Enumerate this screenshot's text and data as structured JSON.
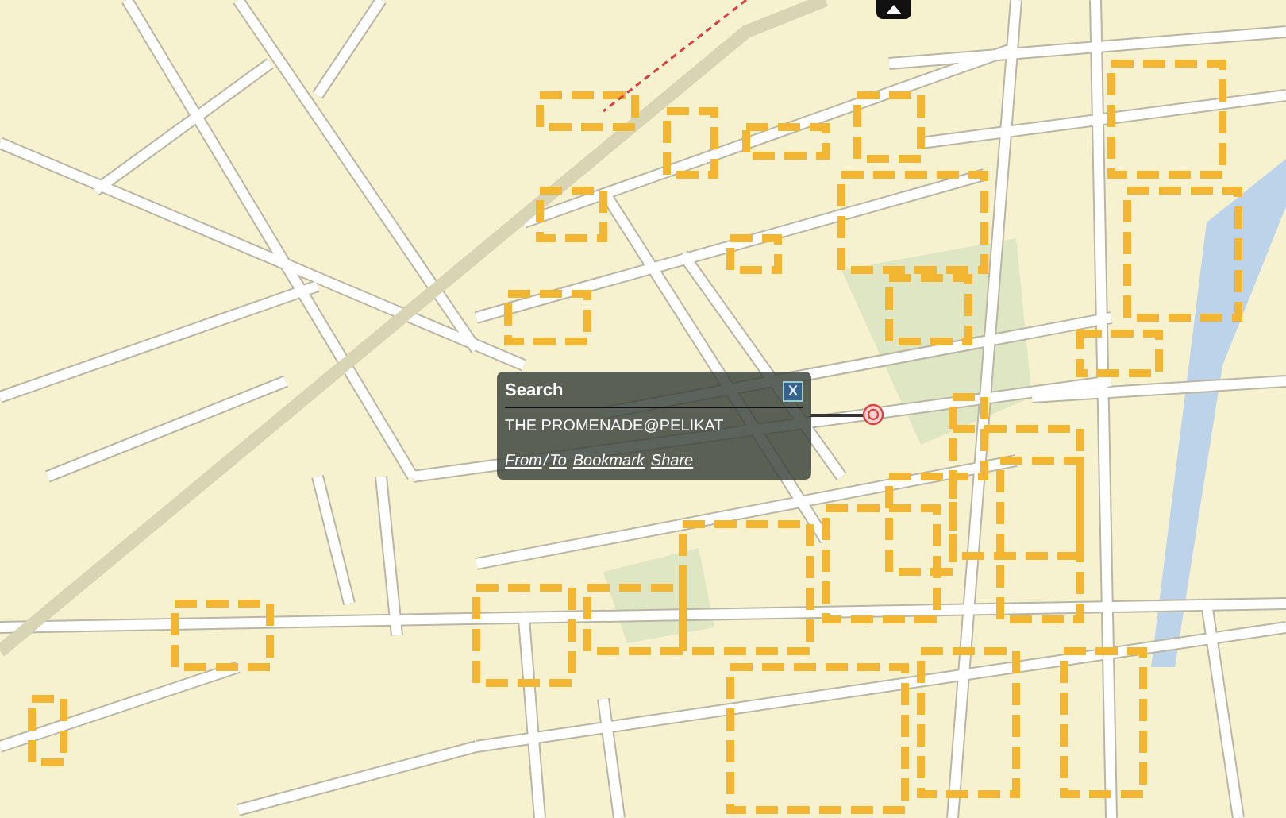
{
  "popup": {
    "title": "Search",
    "close": "X",
    "place": "THE PROMENADE@PELIKAT",
    "links": [
      {
        "kind": "link",
        "text": "From"
      },
      {
        "kind": "sep",
        "text": "/"
      },
      {
        "kind": "link",
        "text": "To"
      },
      {
        "kind": "link",
        "text": "Bookmark"
      },
      {
        "kind": "link",
        "text": "Share"
      }
    ]
  }
}
